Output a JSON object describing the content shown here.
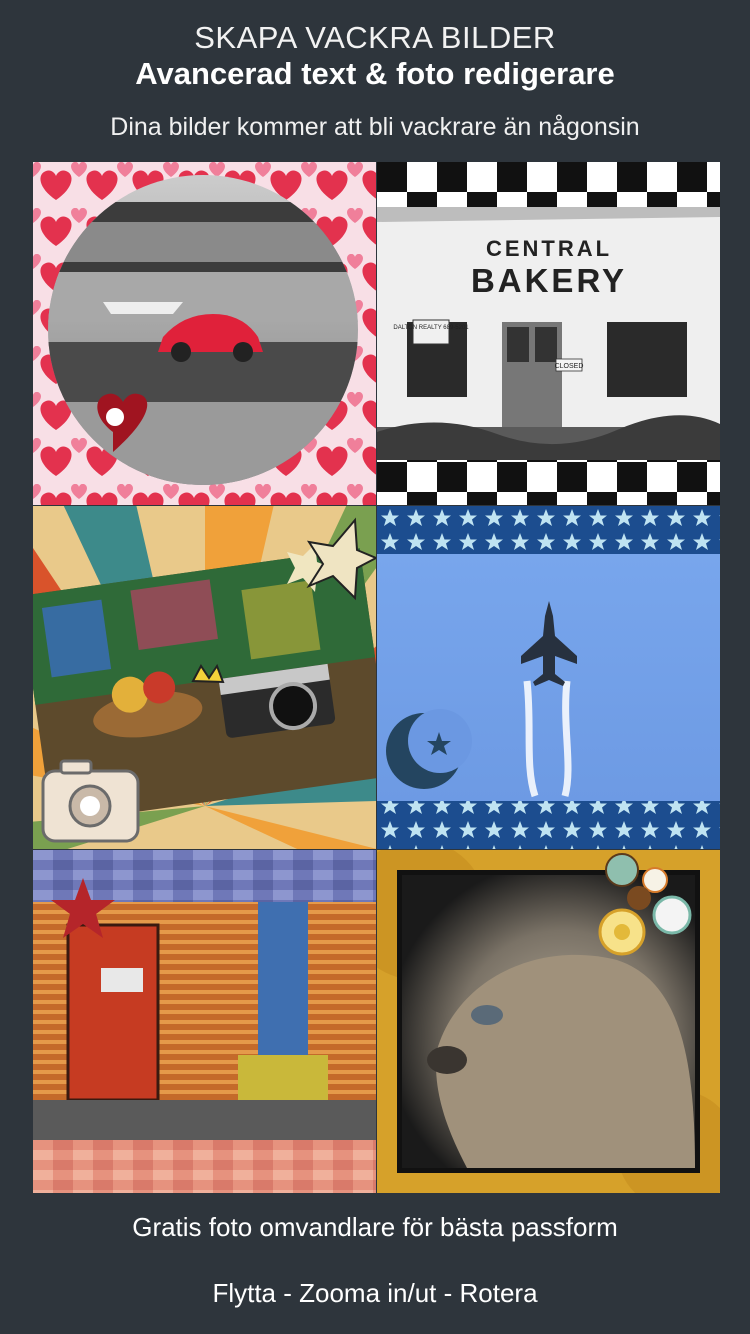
{
  "header": {
    "tagline": "SKAPA VACKRA BILDER",
    "title": "Avancerad text & foto redigerare",
    "subtitle": "Dina bilder kommer att bli vackrare än någonsin"
  },
  "gallery": {
    "bakery_sign_line1": "CENTRAL",
    "bakery_sign_line2": "BAKERY",
    "bakery_realty_sign": "DALTON REALTY 689-5201",
    "bakery_closed_sign": "CLOSED"
  },
  "footer": {
    "line1": "Gratis foto omvandlare för bästa passform",
    "line2": "Flytta - Zooma in/ut - Rotera"
  },
  "colors": {
    "background": "#2e353c",
    "text": "#ffffff"
  }
}
